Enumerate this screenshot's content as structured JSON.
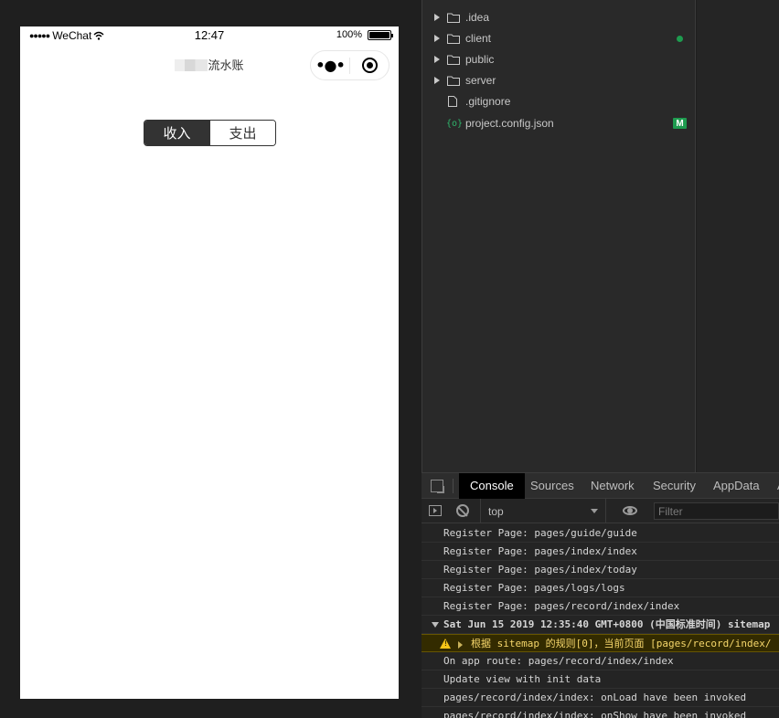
{
  "simulator": {
    "status_bar": {
      "signal": "●●●●●",
      "carrier": "WeChat",
      "time": "12:47",
      "battery": "100%"
    },
    "nav": {
      "title": "流水账"
    },
    "segment": {
      "options": [
        "收入",
        "支出"
      ],
      "selected": "收入"
    }
  },
  "file_tree": {
    "items": [
      {
        "label": ".idea",
        "type": "folder"
      },
      {
        "label": "client",
        "type": "folder",
        "status": "dot"
      },
      {
        "label": "public",
        "type": "folder"
      },
      {
        "label": "server",
        "type": "folder"
      },
      {
        "label": ".gitignore",
        "type": "file"
      },
      {
        "label": "project.config.json",
        "type": "json",
        "status": "M"
      }
    ],
    "json_icon": "{o}",
    "status_badge": "M"
  },
  "devtools": {
    "tabs": [
      "Console",
      "Sources",
      "Network",
      "Security",
      "AppData",
      "A"
    ],
    "active_tab": "Console",
    "context": "top",
    "filter_placeholder": "Filter",
    "console": [
      {
        "type": "log",
        "text": "Register Page: pages/guide/guide"
      },
      {
        "type": "log",
        "text": "Register Page: pages/index/index"
      },
      {
        "type": "log",
        "text": "Register Page: pages/index/today"
      },
      {
        "type": "log",
        "text": "Register Page: pages/logs/logs"
      },
      {
        "type": "log",
        "text": "Register Page: pages/record/index/index"
      },
      {
        "type": "group",
        "text": "Sat Jun 15 2019 12:35:40 GMT+0800 (中国标准时间) sitemap"
      },
      {
        "type": "warn",
        "text": "根据 sitemap 的规则[0]，当前页面 [pages/record/index/"
      },
      {
        "type": "log",
        "text": "On app route: pages/record/index/index"
      },
      {
        "type": "log",
        "text": "Update view with init data"
      },
      {
        "type": "log",
        "text": "pages/record/index/index: onLoad have been invoked"
      },
      {
        "type": "log",
        "text": "pages/record/index/index: onShow have been invoked"
      }
    ]
  },
  "colors": {
    "segment_active": "#333333",
    "git_status": "#1e9b4f",
    "warn_text": "#f5d66b"
  }
}
